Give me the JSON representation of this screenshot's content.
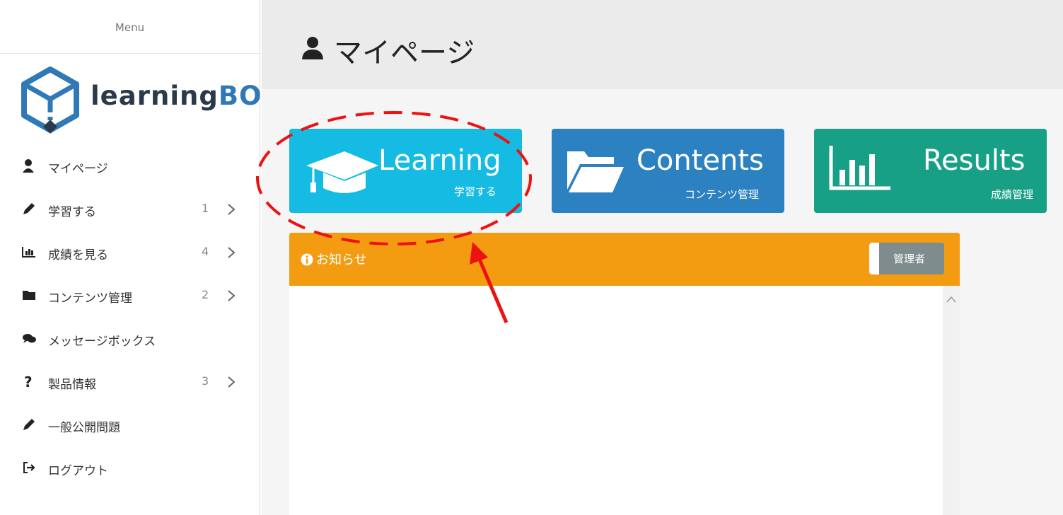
{
  "sidebar": {
    "menu_title": "Menu",
    "logo": {
      "text_part1": "learning",
      "text_part2": "BOX"
    },
    "items": [
      {
        "label": "マイページ",
        "icon": "user-icon",
        "count": ""
      },
      {
        "label": "学習する",
        "icon": "pencil-icon",
        "count": "1"
      },
      {
        "label": "成績を見る",
        "icon": "bar-chart-icon",
        "count": "4"
      },
      {
        "label": "コンテンツ管理",
        "icon": "folder-icon",
        "count": "2"
      },
      {
        "label": "メッセージボックス",
        "icon": "comments-icon",
        "count": ""
      },
      {
        "label": "製品情報",
        "icon": "question-icon",
        "count": "3"
      },
      {
        "label": "一般公開問題",
        "icon": "pencil-icon",
        "count": ""
      },
      {
        "label": "ログアウト",
        "icon": "sign-out-icon",
        "count": ""
      }
    ]
  },
  "header": {
    "title": "マイページ",
    "icon": "user-icon"
  },
  "tiles": {
    "learning": {
      "title": "Learning",
      "subtitle": "学習する",
      "icon": "graduation-cap-icon",
      "color": "#15bbe2"
    },
    "contents": {
      "title": "Contents",
      "subtitle": "コンテンツ管理",
      "icon": "folder-open-icon",
      "color": "#2c81c0"
    },
    "results": {
      "title": "Results",
      "subtitle": "成績管理",
      "icon": "bar-chart-icon",
      "color": "#18a086"
    }
  },
  "notice": {
    "title": "お知らせ",
    "icon": "info-circle-icon",
    "badge": "管理者",
    "color": "#f39c12"
  },
  "annotation": {
    "color": "#ee1111",
    "shape": "dashed-ellipse-and-arrow"
  }
}
